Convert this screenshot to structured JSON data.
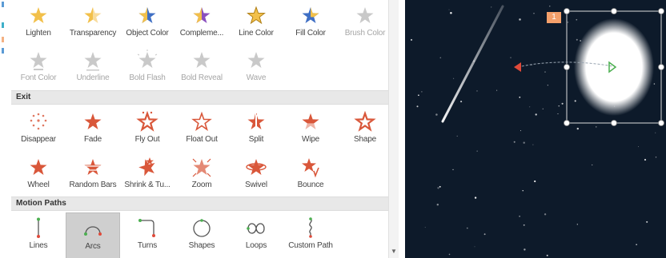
{
  "palette": {
    "emphasis_gold": "#f2c04a",
    "blue": "#3f6fc4",
    "purple": "#8a4fbf",
    "disabled": "#c9c9c9",
    "exit_red": "#d9573a",
    "path_green": "#4caf50",
    "path_red": "#e04a3a",
    "slide_bg": "#0d1a2a"
  },
  "emphasis_rows": [
    [
      {
        "label": "Lighten",
        "icon": "star-lighten-icon"
      },
      {
        "label": "Transparency",
        "icon": "star-transparency-icon"
      },
      {
        "label": "Object Color",
        "icon": "star-object-color-icon"
      },
      {
        "label": "Compleme...",
        "icon": "star-complementary-icon"
      },
      {
        "label": "Line Color",
        "icon": "star-line-color-icon"
      },
      {
        "label": "Fill Color",
        "icon": "star-fill-color-icon"
      },
      {
        "label": "Brush Color",
        "icon": "star-brush-color-icon",
        "disabled": true
      }
    ],
    [
      {
        "label": "Font Color",
        "icon": "star-font-color-icon",
        "disabled": true
      },
      {
        "label": "Underline",
        "icon": "star-underline-icon",
        "disabled": true
      },
      {
        "label": "Bold Flash",
        "icon": "star-bold-flash-icon",
        "disabled": true
      },
      {
        "label": "Bold Reveal",
        "icon": "star-bold-reveal-icon",
        "disabled": true
      },
      {
        "label": "Wave",
        "icon": "star-wave-icon",
        "disabled": true
      }
    ]
  ],
  "exit": {
    "header": "Exit",
    "rows": [
      [
        {
          "label": "Disappear",
          "icon": "star-disappear-icon"
        },
        {
          "label": "Fade",
          "icon": "star-fade-icon"
        },
        {
          "label": "Fly Out",
          "icon": "star-fly-out-icon"
        },
        {
          "label": "Float Out",
          "icon": "star-float-out-icon"
        },
        {
          "label": "Split",
          "icon": "star-split-icon"
        },
        {
          "label": "Wipe",
          "icon": "star-wipe-icon"
        },
        {
          "label": "Shape",
          "icon": "star-shape-icon"
        }
      ],
      [
        {
          "label": "Wheel",
          "icon": "star-wheel-icon"
        },
        {
          "label": "Random Bars",
          "icon": "star-random-bars-icon"
        },
        {
          "label": "Shrink & Tu...",
          "icon": "star-shrink-turn-icon"
        },
        {
          "label": "Zoom",
          "icon": "star-zoom-icon"
        },
        {
          "label": "Swivel",
          "icon": "star-swivel-icon"
        },
        {
          "label": "Bounce",
          "icon": "star-bounce-icon"
        }
      ]
    ]
  },
  "motion_paths": {
    "header": "Motion Paths",
    "items": [
      {
        "label": "Lines",
        "icon": "path-lines-icon"
      },
      {
        "label": "Arcs",
        "icon": "path-arcs-icon",
        "selected": true
      },
      {
        "label": "Turns",
        "icon": "path-turns-icon"
      },
      {
        "label": "Shapes",
        "icon": "path-shapes-icon"
      },
      {
        "label": "Loops",
        "icon": "path-loops-icon"
      },
      {
        "label": "Custom Path",
        "icon": "path-custom-icon"
      }
    ]
  },
  "slide": {
    "animation_order": "1"
  }
}
